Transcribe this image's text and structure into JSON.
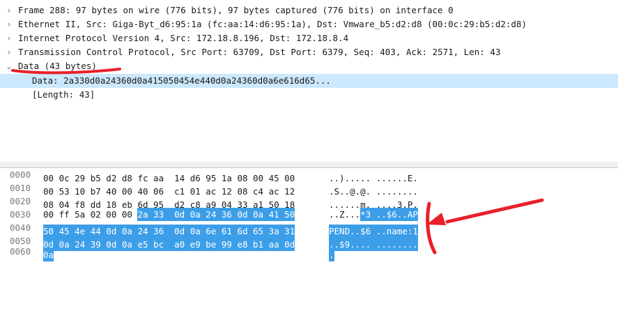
{
  "tree": {
    "rows": [
      {
        "arrow": "›",
        "label": "Frame 288: 97 bytes on wire (776 bits), 97 bytes captured (776 bits) on interface 0"
      },
      {
        "arrow": "›",
        "label": "Ethernet II, Src: Giga-Byt_d6:95:1a (fc:aa:14:d6:95:1a), Dst: Vmware_b5:d2:d8 (00:0c:29:b5:d2:d8)"
      },
      {
        "arrow": "›",
        "label": "Internet Protocol Version 4, Src: 172.18.8.196, Dst: 172.18.8.4"
      },
      {
        "arrow": "›",
        "label": "Transmission Control Protocol, Src Port: 63709, Dst Port: 6379, Seq: 403, Ack: 2571, Len: 43"
      },
      {
        "arrow": "⌄",
        "label": "Data (43 bytes)"
      },
      {
        "label": "Data: 2a330d0a24360d0a415050454e440d0a24360d0a6e616d65..."
      },
      {
        "label": "[Length: 43]"
      }
    ]
  },
  "bytes": {
    "rows": [
      {
        "offset": "0000",
        "hex": [
          "00 0c 29 b5 d2 d8 fc aa  14 d6 95 1a 08 00 45 00",
          ""
        ],
        "ascii": [
          "..)..... ......E.",
          ""
        ]
      },
      {
        "offset": "0010",
        "hex": [
          "00 53 10 b7 40 00 40 06  c1 01 ac 12 08 c4 ac 12",
          ""
        ],
        "ascii": [
          ".S..@.@. ........",
          ""
        ]
      },
      {
        "offset": "0020",
        "hex": [
          "08 04 f8 dd 18 eb 6d 95  d2 c8 a9 04 33 a1 50 18",
          ""
        ],
        "ascii": [
          "......m. ....3.P.",
          ""
        ]
      },
      {
        "offset": "0030",
        "hex": [
          "00 ff 5a 02 00 00 ",
          "2a 33  0d 0a 24 36 0d 0a 41 50"
        ],
        "ascii": [
          "..Z...",
          "*3 ..$6..AP"
        ]
      },
      {
        "offset": "0040",
        "hex": [
          "",
          "50 45 4e 44 0d 0a 24 36  0d 0a 6e 61 6d 65 3a 31"
        ],
        "ascii": [
          "",
          "PEND..$6 ..name:1"
        ]
      },
      {
        "offset": "0050",
        "hex": [
          "",
          "0d 0a 24 39 0d 0a e5 bc  a0 e9 be 99 e8 b1 aa 0d"
        ],
        "ascii": [
          "",
          "..$9.... ........"
        ]
      },
      {
        "offset": "0060",
        "hex": [
          "",
          "0a"
        ],
        "ascii": [
          "",
          "."
        ]
      }
    ]
  },
  "colors": {
    "selection": "#cce8ff",
    "byte_highlight": "#3d9ee8",
    "annotation": "#e8202a"
  }
}
